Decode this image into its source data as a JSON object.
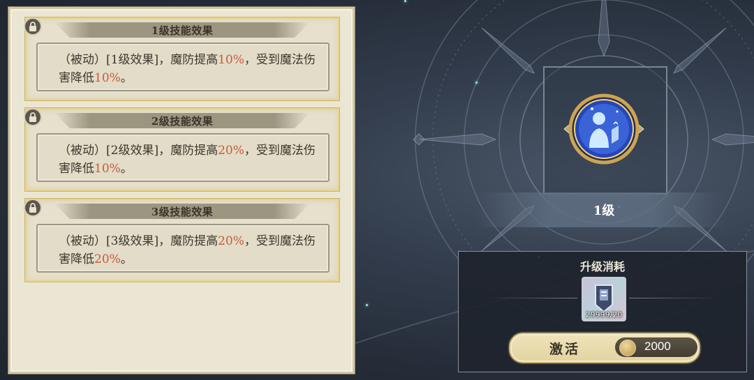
{
  "skills": [
    {
      "title": "1级技能效果",
      "text_parts": [
        "（被动）[1级效果]，魔防提高",
        "10%",
        "，受到魔法伤害降低",
        "10%",
        "。"
      ]
    },
    {
      "title": "2级技能效果",
      "text_parts": [
        "（被动）[2级效果]，魔防提高",
        "20%",
        "，受到魔法伤害降低",
        "10%",
        "。"
      ]
    },
    {
      "title": "3级技能效果",
      "text_parts": [
        "（被动）[3级效果]，魔防提高",
        "20%",
        "，受到魔法伤害降低",
        "20%",
        "。"
      ]
    }
  ],
  "skill_icon": {
    "name": "shield-person-icon"
  },
  "level_label": "1级",
  "upgrade": {
    "title": "升级消耗",
    "item": {
      "name": "skill-book-icon",
      "count": "29999/20"
    },
    "activate_label": "激活",
    "price": "2000",
    "currency_icon": "gold-coin-icon"
  },
  "colors": {
    "highlight": "#c65b3a",
    "panel": "#ebe6d4",
    "accent_gold": "#e8d48a"
  }
}
